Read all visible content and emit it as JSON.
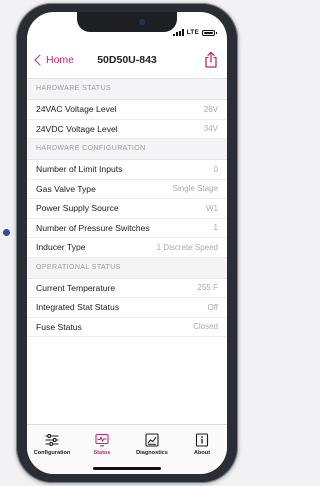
{
  "status_bar": {
    "network": "LTE"
  },
  "nav": {
    "back_label": "Home",
    "title": "50D50U-843"
  },
  "sections": [
    {
      "header": "HARDWARE STATUS",
      "rows": [
        {
          "label": "24VAC Voltage Level",
          "value": "26V"
        },
        {
          "label": "24VDC Voltage Level",
          "value": "34V"
        }
      ]
    },
    {
      "header": "HARDWARE CONFIGURATION",
      "rows": [
        {
          "label": "Number of Limit Inputs",
          "value": "0"
        },
        {
          "label": "Gas Valve Type",
          "value": "Single Stage"
        },
        {
          "label": "Power Supply Source",
          "value": "W1"
        },
        {
          "label": "Number of Pressure Switches",
          "value": "1"
        },
        {
          "label": "Inducer Type",
          "value": "1 Discrete Speed"
        }
      ]
    },
    {
      "header": "OPERATIONAL STATUS",
      "rows": [
        {
          "label": "Current Temperature",
          "value": "255 F"
        },
        {
          "label": "Integrated Stat Status",
          "value": "Off"
        },
        {
          "label": "Fuse Status",
          "value": "Closed"
        }
      ]
    }
  ],
  "tabs": [
    {
      "label": "Configuration",
      "icon": "sliders-icon",
      "active": false
    },
    {
      "label": "Status",
      "icon": "pulse-monitor-icon",
      "active": true
    },
    {
      "label": "Diagnostics",
      "icon": "chart-icon",
      "active": false
    },
    {
      "label": "About",
      "icon": "info-icon",
      "active": false
    }
  ],
  "colors": {
    "accent": "#bf2b6c",
    "section_header_bg": "#f4f4f6",
    "value_text": "#a9a9b0"
  }
}
